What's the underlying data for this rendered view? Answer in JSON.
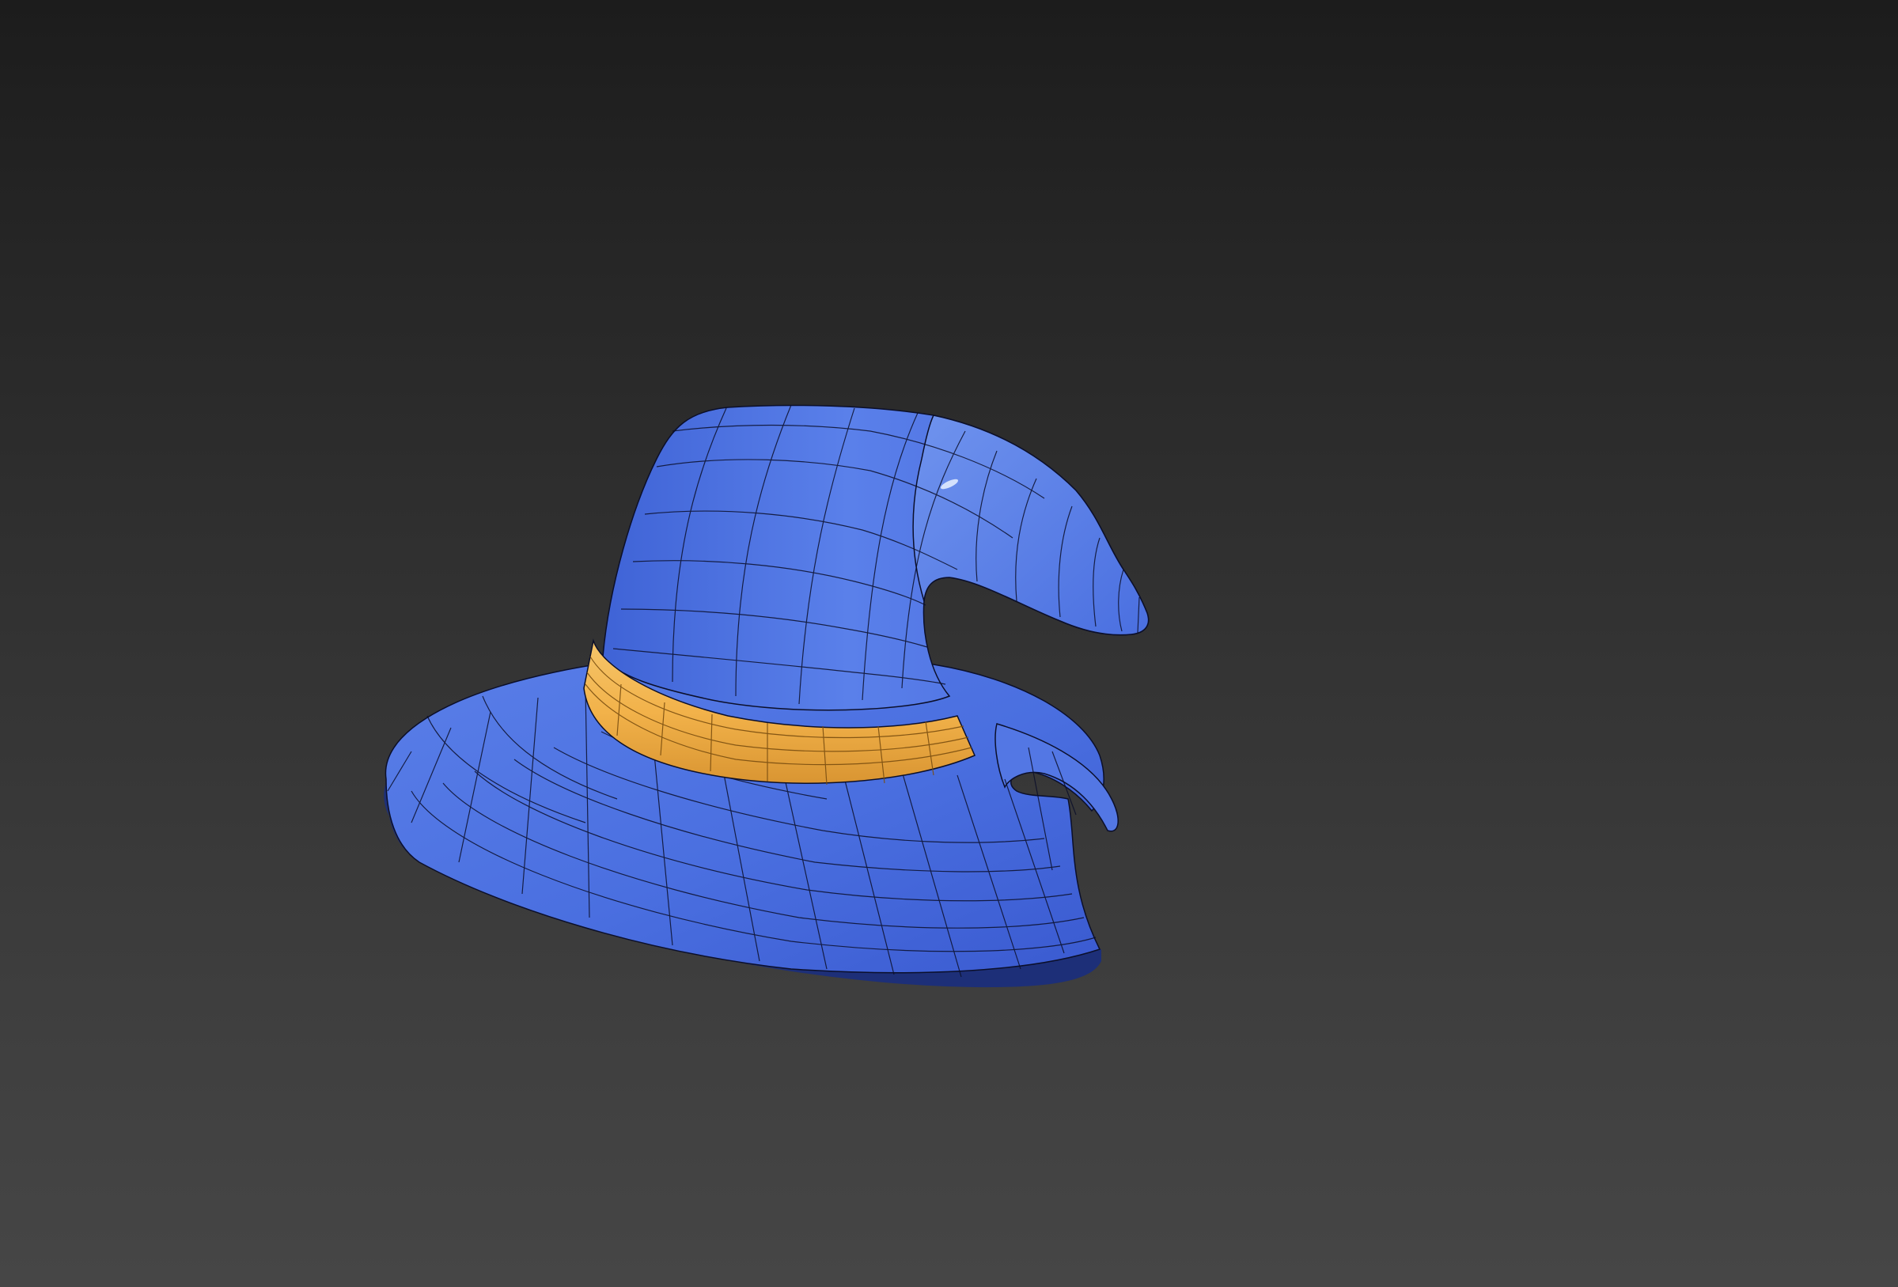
{
  "viewport": {
    "background_top": "#1c1c1c",
    "background_bottom": "#464646"
  },
  "model": {
    "subject": "wizard-hat",
    "body_color": "#4a6fe0",
    "body_highlight": "#6f93ee",
    "body_shadow": "#2f4cb0",
    "band_color": "#f2b24a",
    "band_shadow": "#c98a2a",
    "wire_color": "#0b0f2a"
  }
}
